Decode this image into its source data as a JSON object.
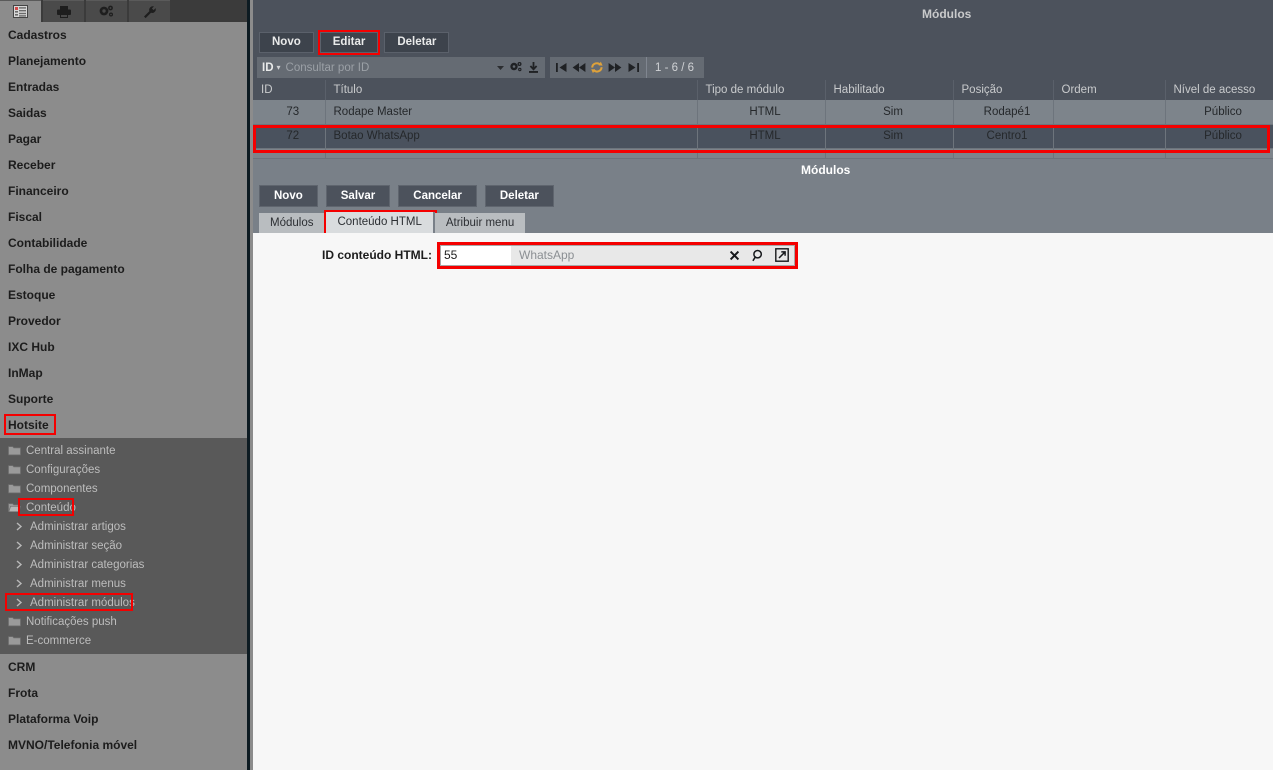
{
  "sidebar": {
    "tabs": [
      {
        "name": "menu-tab",
        "icon": "list-icon",
        "active": true
      },
      {
        "name": "print-tab",
        "icon": "printer-icon",
        "active": false
      },
      {
        "name": "settings-tab",
        "icon": "gears-icon",
        "active": false
      },
      {
        "name": "tools-tab",
        "icon": "wrench-icon",
        "active": false
      }
    ],
    "sections_top": [
      {
        "label": "Cadastros"
      },
      {
        "label": "Planejamento"
      },
      {
        "label": "Entradas"
      },
      {
        "label": "Saidas"
      },
      {
        "label": "Pagar"
      },
      {
        "label": "Receber"
      },
      {
        "label": "Financeiro"
      },
      {
        "label": "Fiscal"
      },
      {
        "label": "Contabilidade"
      },
      {
        "label": "Folha de pagamento"
      },
      {
        "label": "Estoque"
      },
      {
        "label": "Provedor"
      },
      {
        "label": "IXC Hub"
      },
      {
        "label": "InMap"
      },
      {
        "label": "Suporte"
      },
      {
        "label": "Hotsite",
        "highlighted": true
      }
    ],
    "tree": [
      {
        "label": "Central assinante",
        "icon": "folder-icon",
        "type": "folder"
      },
      {
        "label": "Configurações",
        "icon": "folder-icon",
        "type": "folder"
      },
      {
        "label": "Componentes",
        "icon": "folder-icon",
        "type": "folder"
      },
      {
        "label": "Conteúdo",
        "icon": "folder-open-icon",
        "type": "folder",
        "highlighted": true
      },
      {
        "label": "Administrar artigos",
        "icon": "chevron-right-icon",
        "type": "leaf"
      },
      {
        "label": "Administrar seção",
        "icon": "chevron-right-icon",
        "type": "leaf"
      },
      {
        "label": "Administrar categorias",
        "icon": "chevron-right-icon",
        "type": "leaf"
      },
      {
        "label": "Administrar menus",
        "icon": "chevron-right-icon",
        "type": "leaf"
      },
      {
        "label": "Administrar módulos",
        "icon": "chevron-right-icon",
        "type": "leaf",
        "highlighted": true
      },
      {
        "label": "Notificações push",
        "icon": "folder-icon",
        "type": "folder"
      },
      {
        "label": "E-commerce",
        "icon": "folder-icon",
        "type": "folder"
      }
    ],
    "sections_bottom": [
      {
        "label": "CRM"
      },
      {
        "label": "Frota"
      },
      {
        "label": "Plataforma Voip"
      },
      {
        "label": "MVNO/Telefonia móvel"
      }
    ]
  },
  "grid_panel": {
    "title": "Módulos",
    "toolbar": [
      {
        "label": "Novo",
        "name": "new-button",
        "highlighted": false
      },
      {
        "label": "Editar",
        "name": "edit-button",
        "highlighted": true
      },
      {
        "label": "Deletar",
        "name": "delete-button",
        "highlighted": false
      }
    ],
    "search": {
      "field_label": "ID",
      "placeholder": "Consultar por ID"
    },
    "pager": {
      "count_label": "1 - 6 / 6",
      "buttons": [
        "first-page",
        "prev-page",
        "refresh",
        "next-page",
        "last-page"
      ]
    },
    "columns": [
      "ID",
      "Título",
      "Tipo de módulo",
      "Habilitado",
      "Posição",
      "Ordem",
      "Nível de acesso"
    ],
    "rows": [
      {
        "id": "73",
        "titulo": "Rodape Master",
        "tipo": "HTML",
        "habilitado": "Sim",
        "posicao": "Rodapé1",
        "ordem": "",
        "nivel": "Público",
        "selected": false,
        "highlighted": false
      },
      {
        "id": "72",
        "titulo": "Botao WhatsApp",
        "tipo": "HTML",
        "habilitado": "Sim",
        "posicao": "Centro1",
        "ordem": "",
        "nivel": "Público",
        "selected": true,
        "highlighted": true
      },
      {
        "id": "",
        "titulo": "",
        "tipo": "",
        "habilitado": "",
        "posicao": "",
        "ordem": "",
        "nivel": "",
        "selected": false,
        "highlighted": false
      }
    ]
  },
  "form_panel": {
    "title": "Módulos",
    "toolbar": [
      {
        "label": "Novo",
        "name": "form-new-button"
      },
      {
        "label": "Salvar",
        "name": "form-save-button"
      },
      {
        "label": "Cancelar",
        "name": "form-cancel-button"
      },
      {
        "label": "Deletar",
        "name": "form-delete-button"
      }
    ],
    "tabs": [
      {
        "label": "Módulos",
        "name": "tab-modulos",
        "active": false,
        "highlighted": false
      },
      {
        "label": "Conteúdo HTML",
        "name": "tab-conteudo-html",
        "active": true,
        "highlighted": true
      },
      {
        "label": "Atribuir menu",
        "name": "tab-atribuir-menu",
        "active": false,
        "highlighted": false
      }
    ],
    "field": {
      "label": "ID conteúdo HTML:",
      "id_value": "55",
      "display_value": "WhatsApp",
      "icons": [
        "clear-icon",
        "search-icon",
        "open-external-icon"
      ],
      "highlighted": true
    }
  },
  "colors": {
    "highlight": "#f40000",
    "sidebar_bg": "#8c8c8c",
    "tree_bg": "#595959",
    "panel_dark": "#4c525c",
    "panel_gray": "#798088",
    "row_selected": "#4a525e",
    "row_normal": "#7d848b",
    "form_bg": "#f7f7f7"
  }
}
